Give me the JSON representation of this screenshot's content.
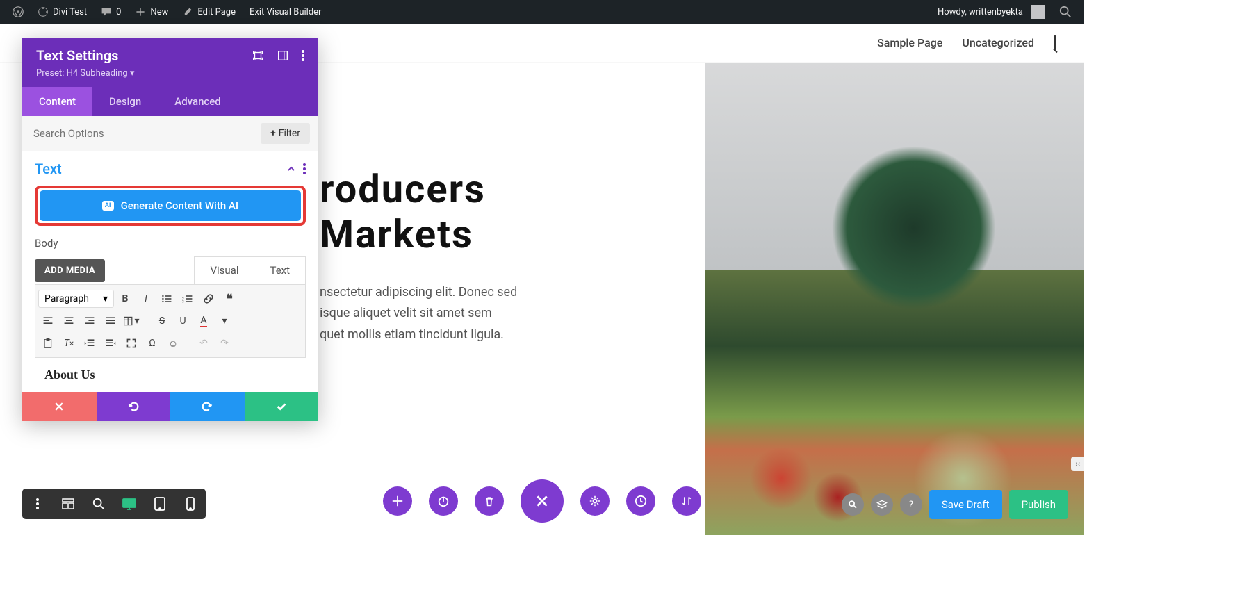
{
  "admin_bar": {
    "site_name": "Divi Test",
    "comments_count": "0",
    "new_label": "New",
    "edit_page": "Edit Page",
    "exit_builder": "Exit Visual Builder",
    "howdy": "Howdy, writtenbyekta"
  },
  "top_nav": {
    "sample_page": "Sample Page",
    "uncategorized": "Uncategorized"
  },
  "hero": {
    "title_line1": "roducers",
    "title_line2": "Markets",
    "para_line1": "nsectetur adipiscing elit. Donec sed",
    "para_line2": "isque aliquet velit sit amet sem",
    "para_line3": "quet mollis etiam tincidunt ligula."
  },
  "settings_panel": {
    "title": "Text Settings",
    "preset": "Preset: H4 Subheading",
    "tabs": {
      "content": "Content",
      "design": "Design",
      "advanced": "Advanced"
    },
    "search_placeholder": "Search Options",
    "filter_label": "Filter",
    "section_title": "Text",
    "ai_button": "Generate Content With AI",
    "ai_badge": "AI",
    "body_label": "Body",
    "add_media": "ADD MEDIA",
    "mode_visual": "Visual",
    "mode_text": "Text",
    "format_select": "Paragraph",
    "editor_content": "About Us"
  },
  "bottom_right": {
    "save_draft": "Save Draft",
    "publish": "Publish"
  }
}
